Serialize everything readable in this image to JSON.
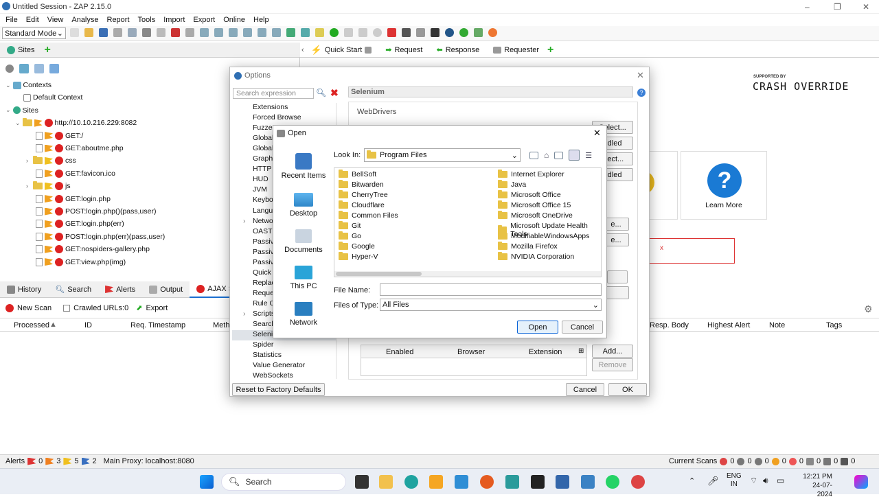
{
  "window": {
    "title": "Untitled Session - ZAP 2.15.0",
    "controls": [
      "–",
      "❐",
      "✕"
    ]
  },
  "menu": [
    "File",
    "Edit",
    "View",
    "Analyse",
    "Report",
    "Tools",
    "Import",
    "Export",
    "Online",
    "Help"
  ],
  "mode_select": "Standard Mode",
  "sites_panel": {
    "tab": "Sites",
    "tree": [
      {
        "label": "Contexts",
        "indent": 0
      },
      {
        "label": "Default Context",
        "indent": 1
      },
      {
        "label": "Sites",
        "indent": 0
      },
      {
        "label": "http://10.10.216.229:8082",
        "indent": 1
      },
      {
        "label": "GET:/",
        "indent": 2
      },
      {
        "label": "GET:aboutme.php",
        "indent": 2
      },
      {
        "label": "css",
        "indent": 2
      },
      {
        "label": "GET:favicon.ico",
        "indent": 2
      },
      {
        "label": "js",
        "indent": 2
      },
      {
        "label": "GET:login.php",
        "indent": 2
      },
      {
        "label": "POST:login.php()(pass,user)",
        "indent": 2
      },
      {
        "label": "GET:login.php(err)",
        "indent": 2
      },
      {
        "label": "POST:login.php(err)(pass,user)",
        "indent": 2
      },
      {
        "label": "GET:nospiders-gallery.php",
        "indent": 2
      },
      {
        "label": "GET:view.php(img)",
        "indent": 2
      }
    ]
  },
  "workspace_tabs": [
    "Quick Start",
    "Request",
    "Response",
    "Requester"
  ],
  "quickstart": {
    "supported_by": "SUPPORTED BY",
    "sponsor": "CRASH OVERRIDE",
    "learn_more": "Learn More",
    "x_mark": "x"
  },
  "bottom_tabs": [
    "History",
    "Search",
    "Alerts",
    "Output",
    "AJAX Spid"
  ],
  "bottom_toolbar": {
    "new_scan": "New Scan",
    "crawled": "Crawled URLs:0",
    "export": "Export"
  },
  "bottom_columns": [
    "Processed",
    "ID",
    "Req. Timestamp",
    "Meth",
    "Resp. Body",
    "Highest Alert",
    "Note",
    "Tags"
  ],
  "options_dialog": {
    "title": "Options",
    "search_placeholder": "Search expression",
    "section_title": "Selenium",
    "webdrivers_label": "WebDrivers",
    "nav_items": [
      "Extensions",
      "Forced Browse",
      "Fuzzer",
      "Global",
      "Global",
      "Graphi",
      "HTTP",
      "HUD",
      "JVM",
      "Keybo",
      "Langu",
      "Netwo",
      "OAST",
      "Passiv",
      "Passiv",
      "Passiv",
      "Quick",
      "Replac",
      "Reque",
      "Rule C",
      "Scripts",
      "Search",
      "Seleni",
      "Spider",
      "Statistics",
      "Value Generator",
      "WebSockets"
    ],
    "right_buttons": [
      "Select...",
      "ndled",
      "elect...",
      "ndled"
    ],
    "extra_buttons": [
      "e...",
      "e..."
    ],
    "table_columns": [
      "Enabled",
      "Browser",
      "Extension"
    ],
    "add": "Add...",
    "remove": "Remove",
    "reset": "Reset to Factory Defaults",
    "cancel": "Cancel",
    "ok": "OK"
  },
  "open_dialog": {
    "title": "Open",
    "look_in_label": "Look In:",
    "look_in_value": "Program Files",
    "places": [
      "Recent Items",
      "Desktop",
      "Documents",
      "This PC",
      "Network"
    ],
    "files_col1": [
      "BellSoft",
      "Bitwarden",
      "CherryTree",
      "Cloudflare",
      "Common Files",
      "Git",
      "Go",
      "Google",
      "Hyper-V"
    ],
    "files_col2": [
      "Internet Explorer",
      "Java",
      "Microsoft Office",
      "Microsoft Office 15",
      "Microsoft OneDrive",
      "Microsoft Update Health Tools",
      "ModifiableWindowsApps",
      "Mozilla Firefox",
      "NVIDIA Corporation"
    ],
    "file_name_label": "File Name:",
    "file_name_value": "",
    "files_of_type_label": "Files of Type:",
    "files_of_type_value": "All Files",
    "open": "Open",
    "cancel": "Cancel"
  },
  "status_bar": {
    "alerts_label": "Alerts",
    "counts": [
      "0",
      "3",
      "5",
      "2"
    ],
    "proxy": "Main Proxy: localhost:8080",
    "current_scans": "Current Scans",
    "scan_counts": [
      "0",
      "0",
      "0",
      "0",
      "0",
      "0",
      "0",
      "0"
    ]
  },
  "taskbar": {
    "search": "Search",
    "lang1": "ENG",
    "lang2": "IN",
    "time": "12:21 PM",
    "date": "24-07-2024"
  }
}
